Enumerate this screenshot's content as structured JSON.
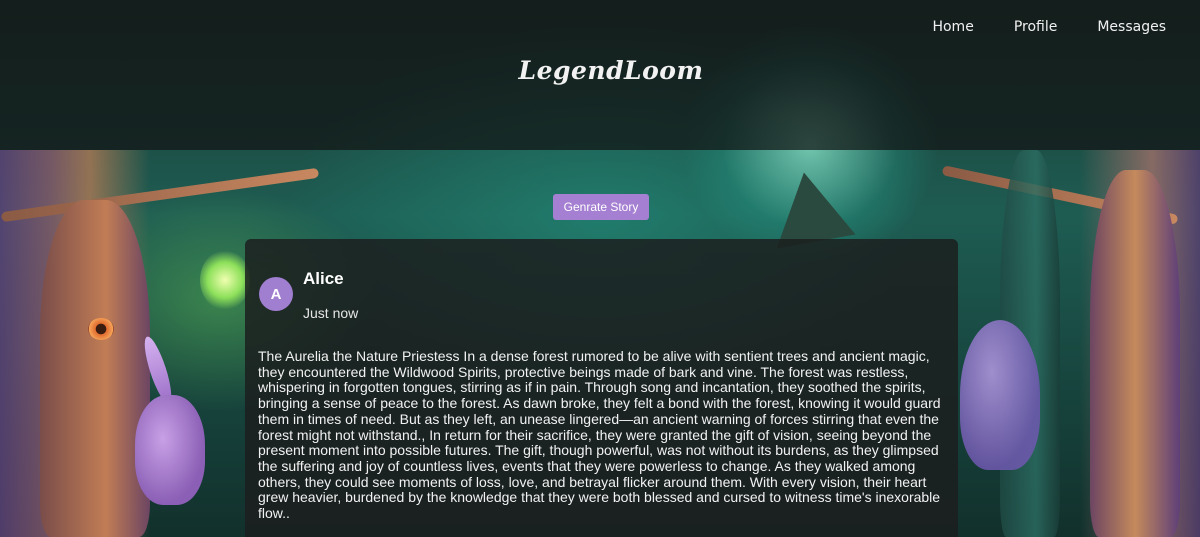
{
  "header": {
    "brand": "LegendLoom",
    "nav": [
      {
        "label": "Home"
      },
      {
        "label": "Profile"
      },
      {
        "label": "Messages"
      }
    ]
  },
  "actions": {
    "generate_label": "Genrate Story"
  },
  "post": {
    "avatar_initial": "A",
    "author": "Alice",
    "timestamp": "Just now",
    "body": "The Aurelia the Nature Priestess In a dense forest rumored to be alive with sentient trees and ancient magic, they encountered the Wildwood Spirits, protective beings made of bark and vine. The forest was restless, whispering in forgotten tongues, stirring as if in pain. Through song and incantation, they soothed the spirits, bringing a sense of peace to the forest. As dawn broke, they felt a bond with the forest, knowing it would guard them in times of need. But as they left, an unease lingered—an ancient warning of forces stirring that even the forest might not withstand., In return for their sacrifice, they were granted the gift of vision, seeing beyond the present moment into possible futures. The gift, though powerful, was not without its burdens, as they glimpsed the suffering and joy of countless lives, events that they were powerless to change. As they walked among others, they could see moments of loss, love, and betrayal flicker around them. With every vision, their heart grew heavier, burdened by the knowledge that they were both blessed and cursed to witness time's inexorable flow.."
  },
  "colors": {
    "accent": "#a57fd1",
    "avatar_bg": "#a07ed0",
    "card_bg": "rgba(28,30,30,0.84)",
    "header_bg": "rgba(18,20,20,0.72)"
  }
}
